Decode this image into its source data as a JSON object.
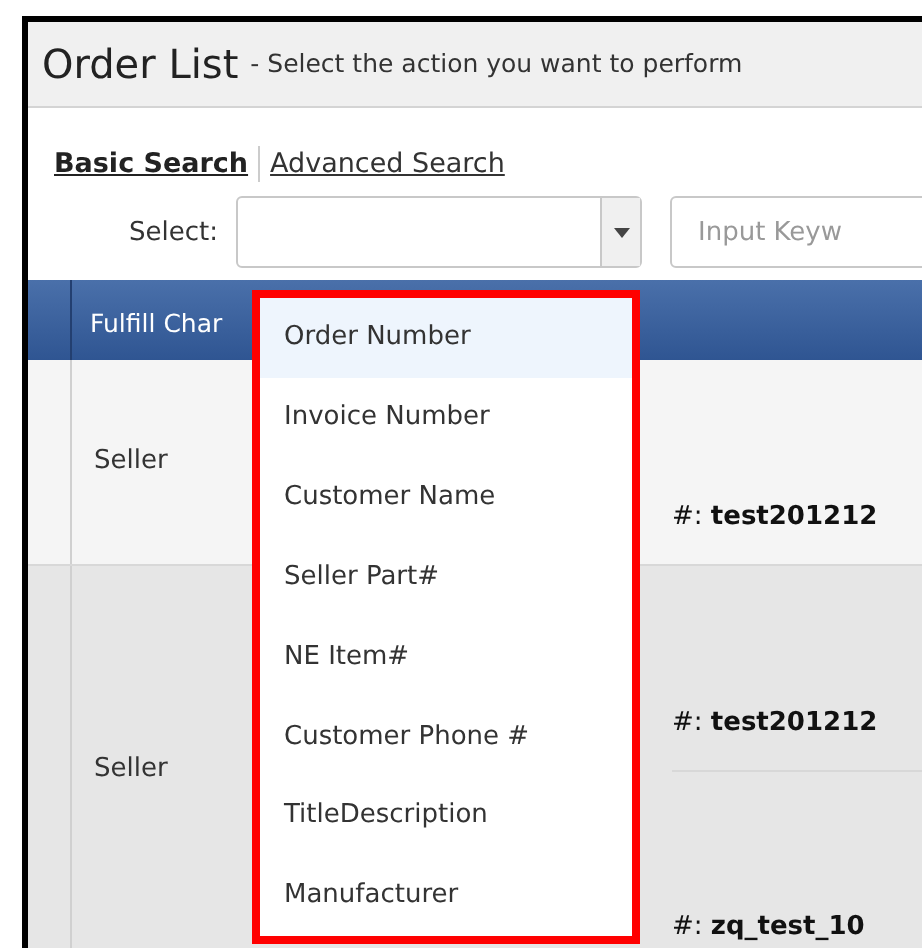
{
  "header": {
    "title": "Order List",
    "subtitle": "- Select the action you want to perform"
  },
  "search_tabs": [
    {
      "label": "Basic Search",
      "selected": true
    },
    {
      "label": "Advanced Search",
      "selected": false
    }
  ],
  "select_field": {
    "label": "Select:"
  },
  "keyword_field": {
    "placeholder": "Input Keyw"
  },
  "table": {
    "columns": [
      {
        "label": "Fulfill Char"
      }
    ],
    "rows": [
      {
        "column_2": "Seller",
        "lines": [
          "#: **test201212**"
        ]
      },
      {
        "column_2": "Seller",
        "lines": [
          "#: **test201212**",
          "#: **zq_test_10**"
        ]
      }
    ]
  },
  "dropdown": {
    "options": [
      {
        "label": "Order Number",
        "selected": true
      },
      {
        "label": "Invoice Number",
        "selected": false
      },
      {
        "label": "Customer Name",
        "selected": false
      },
      {
        "label": "Seller Part#",
        "selected": false
      },
      {
        "label": "NE Item#",
        "selected": false
      },
      {
        "label": "Customer Phone #",
        "selected": false
      },
      {
        "label": "TitleDescription",
        "selected": false
      },
      {
        "label": "Manufacturer",
        "selected": false
      }
    ]
  }
}
